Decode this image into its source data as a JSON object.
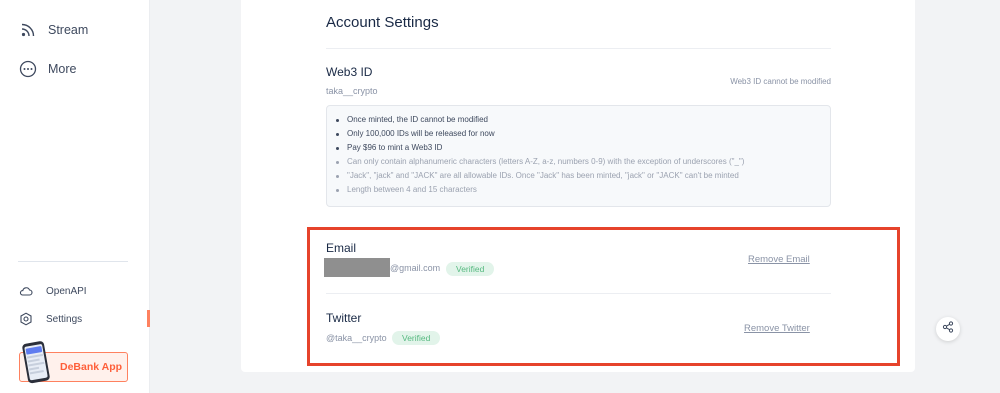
{
  "sidebar": {
    "items": [
      {
        "label": "Stream",
        "icon": "rss-icon"
      },
      {
        "label": "More",
        "icon": "more-icon"
      }
    ],
    "bottom_items": [
      {
        "label": "OpenAPI",
        "icon": "cloud-icon"
      },
      {
        "label": "Settings",
        "icon": "settings-icon",
        "active": true
      }
    ],
    "app_banner": {
      "label": "DeBank App"
    }
  },
  "page": {
    "title": "Account Settings"
  },
  "web3": {
    "label": "Web3 ID",
    "value": "taka__crypto",
    "note": "Web3 ID cannot be modified",
    "rules": [
      "Once minted, the ID cannot be modified",
      "Only 100,000 IDs will be released for now",
      "Pay $96 to mint a Web3 ID",
      "Can only contain alphanumeric characters (letters A-Z, a-z, numbers 0-9) with the exception of underscores (\"_\")",
      "\"Jack\", \"jack\" and \"JACK\" are all allowable IDs. Once \"Jack\" has been minted, \"jack\" or \"JACK\" can't be minted",
      "Length between 4 and 15 characters"
    ]
  },
  "email": {
    "label": "Email",
    "domain": "@gmail.com",
    "status": "Verified",
    "action": "Remove Email"
  },
  "twitter": {
    "label": "Twitter",
    "handle": "@taka__crypto",
    "status": "Verified",
    "action": "Remove Twitter"
  },
  "colors": {
    "accent": "#fe815f",
    "highlight": "#e6432b",
    "verified_bg": "#e2f4ea",
    "verified_text": "#56b980"
  }
}
